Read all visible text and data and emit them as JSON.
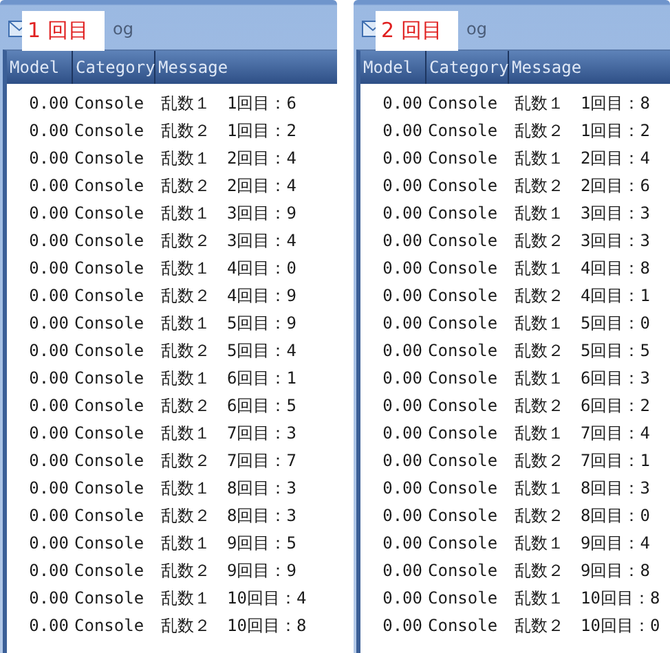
{
  "panels": [
    {
      "label": "1 回目",
      "title": "og",
      "columns": [
        "Model",
        "Category",
        "Message"
      ],
      "rows": [
        {
          "model": "0.00",
          "category": "Console",
          "message": "乱数１　1回目：6"
        },
        {
          "model": "0.00",
          "category": "Console",
          "message": "乱数２　1回目：2"
        },
        {
          "model": "0.00",
          "category": "Console",
          "message": "乱数１　2回目：4"
        },
        {
          "model": "0.00",
          "category": "Console",
          "message": "乱数２　2回目：4"
        },
        {
          "model": "0.00",
          "category": "Console",
          "message": "乱数１　3回目：9"
        },
        {
          "model": "0.00",
          "category": "Console",
          "message": "乱数２　3回目：4"
        },
        {
          "model": "0.00",
          "category": "Console",
          "message": "乱数１　4回目：0"
        },
        {
          "model": "0.00",
          "category": "Console",
          "message": "乱数２　4回目：9"
        },
        {
          "model": "0.00",
          "category": "Console",
          "message": "乱数１　5回目：9"
        },
        {
          "model": "0.00",
          "category": "Console",
          "message": "乱数２　5回目：4"
        },
        {
          "model": "0.00",
          "category": "Console",
          "message": "乱数１　6回目：1"
        },
        {
          "model": "0.00",
          "category": "Console",
          "message": "乱数２　6回目：5"
        },
        {
          "model": "0.00",
          "category": "Console",
          "message": "乱数１　7回目：3"
        },
        {
          "model": "0.00",
          "category": "Console",
          "message": "乱数２　7回目：7"
        },
        {
          "model": "0.00",
          "category": "Console",
          "message": "乱数１　8回目：3"
        },
        {
          "model": "0.00",
          "category": "Console",
          "message": "乱数２　8回目：3"
        },
        {
          "model": "0.00",
          "category": "Console",
          "message": "乱数１　9回目：5"
        },
        {
          "model": "0.00",
          "category": "Console",
          "message": "乱数２　9回目：9"
        },
        {
          "model": "0.00",
          "category": "Console",
          "message": "乱数１　10回目：4"
        },
        {
          "model": "0.00",
          "category": "Console",
          "message": "乱数２　10回目：8"
        }
      ]
    },
    {
      "label": "2 回目",
      "title": "og",
      "columns": [
        "Model",
        "Category",
        "Message"
      ],
      "rows": [
        {
          "model": "0.00",
          "category": "Console",
          "message": "乱数１　1回目：8"
        },
        {
          "model": "0.00",
          "category": "Console",
          "message": "乱数２　1回目：2"
        },
        {
          "model": "0.00",
          "category": "Console",
          "message": "乱数１　2回目：4"
        },
        {
          "model": "0.00",
          "category": "Console",
          "message": "乱数２　2回目：6"
        },
        {
          "model": "0.00",
          "category": "Console",
          "message": "乱数１　3回目：3"
        },
        {
          "model": "0.00",
          "category": "Console",
          "message": "乱数２　3回目：3"
        },
        {
          "model": "0.00",
          "category": "Console",
          "message": "乱数１　4回目：8"
        },
        {
          "model": "0.00",
          "category": "Console",
          "message": "乱数２　4回目：1"
        },
        {
          "model": "0.00",
          "category": "Console",
          "message": "乱数１　5回目：0"
        },
        {
          "model": "0.00",
          "category": "Console",
          "message": "乱数２　5回目：5"
        },
        {
          "model": "0.00",
          "category": "Console",
          "message": "乱数１　6回目：3"
        },
        {
          "model": "0.00",
          "category": "Console",
          "message": "乱数２　6回目：2"
        },
        {
          "model": "0.00",
          "category": "Console",
          "message": "乱数１　7回目：4"
        },
        {
          "model": "0.00",
          "category": "Console",
          "message": "乱数２　7回目：1"
        },
        {
          "model": "0.00",
          "category": "Console",
          "message": "乱数１　8回目：3"
        },
        {
          "model": "0.00",
          "category": "Console",
          "message": "乱数２　8回目：0"
        },
        {
          "model": "0.00",
          "category": "Console",
          "message": "乱数１　9回目：4"
        },
        {
          "model": "0.00",
          "category": "Console",
          "message": "乱数２　9回目：8"
        },
        {
          "model": "0.00",
          "category": "Console",
          "message": "乱数１　10回目：8"
        },
        {
          "model": "0.00",
          "category": "Console",
          "message": "乱数２　10回目：0"
        }
      ]
    }
  ]
}
